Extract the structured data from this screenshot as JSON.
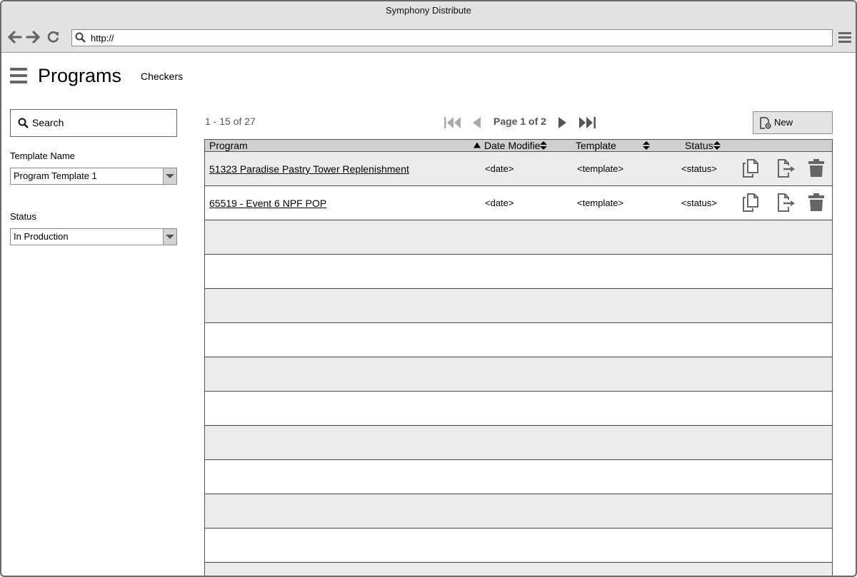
{
  "window": {
    "title": "Symphony Distribute"
  },
  "browser": {
    "url": "http://"
  },
  "header": {
    "title": "Programs",
    "nav_link": "Checkers"
  },
  "filters": {
    "search_label": "Search",
    "template_label": "Template Name",
    "template_value": "Program Template 1",
    "status_label": "Status",
    "status_value": "In Production"
  },
  "pagination": {
    "range": "1 - 15 of 27",
    "page": "Page 1 of 2"
  },
  "toolbar": {
    "new_label": "New"
  },
  "table": {
    "columns": [
      "Program",
      "Date Modifie",
      "Template",
      "Status"
    ],
    "rows": [
      {
        "program": "51323 Paradise Pastry Tower Replenishment",
        "date": "<date>",
        "template": "<template>",
        "status": "<status>"
      },
      {
        "program": "65519 - Event 6 NPF POP",
        "date": "<date>",
        "template": "<template>",
        "status": "<status>"
      }
    ]
  },
  "colors": {
    "chrome": "#e2e2e2",
    "header_row": "#d0d0d0",
    "shaded_row": "#ececec",
    "icon": "#666666"
  }
}
